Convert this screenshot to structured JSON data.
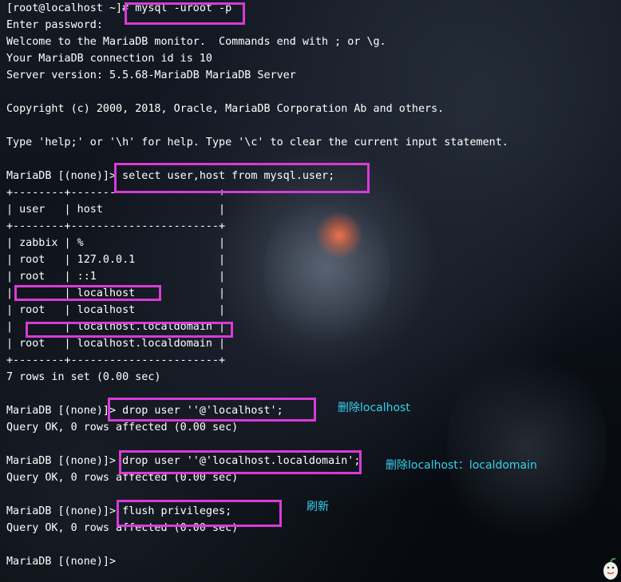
{
  "terminal": {
    "lines": [
      "[root@localhost ~]# mysql -uroot -p",
      "Enter password:",
      "Welcome to the MariaDB monitor.  Commands end with ; or \\g.",
      "Your MariaDB connection id is 10",
      "Server version: 5.5.68-MariaDB MariaDB Server",
      "",
      "Copyright (c) 2000, 2018, Oracle, MariaDB Corporation Ab and others.",
      "",
      "Type 'help;' or '\\h' for help. Type '\\c' to clear the current input statement.",
      "",
      "MariaDB [(none)]> select user,host from mysql.user;",
      "+--------+-----------------------+",
      "| user   | host                  |",
      "+--------+-----------------------+",
      "| zabbix | %                     |",
      "| root   | 127.0.0.1             |",
      "| root   | ::1                   |",
      "|        | localhost             |",
      "| root   | localhost             |",
      "|        | localhost.localdomain |",
      "| root   | localhost.localdomain |",
      "+--------+-----------------------+",
      "7 rows in set (0.00 sec)",
      "",
      "MariaDB [(none)]> drop user ''@'localhost';",
      "Query OK, 0 rows affected (0.00 sec)",
      "",
      "MariaDB [(none)]> drop user ''@'localhost.localdomain';",
      "Query OK, 0 rows affected (0.00 sec)",
      "",
      "MariaDB [(none)]> flush privileges;",
      "Query OK, 0 rows affected (0.00 sec)",
      "",
      "MariaDB [(none)]> "
    ]
  },
  "annotations": {
    "note_drop_localhost": "删除localhost",
    "note_drop_localdomain": "删除localhost：localdomain",
    "note_flush": "刷新"
  },
  "colors": {
    "highlight": "#d93ad9",
    "note": "#34d2ee",
    "text": "#ffffff"
  }
}
